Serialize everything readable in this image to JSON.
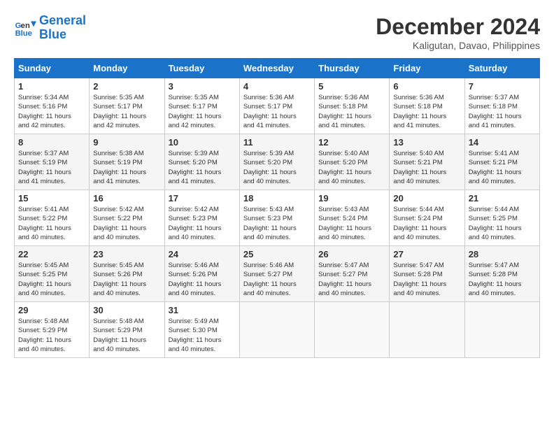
{
  "header": {
    "logo_line1": "General",
    "logo_line2": "Blue",
    "month_title": "December 2024",
    "location": "Kaligutan, Davao, Philippines"
  },
  "weekdays": [
    "Sunday",
    "Monday",
    "Tuesday",
    "Wednesday",
    "Thursday",
    "Friday",
    "Saturday"
  ],
  "weeks": [
    [
      {
        "day": "1",
        "info": "Sunrise: 5:34 AM\nSunset: 5:16 PM\nDaylight: 11 hours\nand 42 minutes."
      },
      {
        "day": "2",
        "info": "Sunrise: 5:35 AM\nSunset: 5:17 PM\nDaylight: 11 hours\nand 42 minutes."
      },
      {
        "day": "3",
        "info": "Sunrise: 5:35 AM\nSunset: 5:17 PM\nDaylight: 11 hours\nand 42 minutes."
      },
      {
        "day": "4",
        "info": "Sunrise: 5:36 AM\nSunset: 5:17 PM\nDaylight: 11 hours\nand 41 minutes."
      },
      {
        "day": "5",
        "info": "Sunrise: 5:36 AM\nSunset: 5:18 PM\nDaylight: 11 hours\nand 41 minutes."
      },
      {
        "day": "6",
        "info": "Sunrise: 5:36 AM\nSunset: 5:18 PM\nDaylight: 11 hours\nand 41 minutes."
      },
      {
        "day": "7",
        "info": "Sunrise: 5:37 AM\nSunset: 5:18 PM\nDaylight: 11 hours\nand 41 minutes."
      }
    ],
    [
      {
        "day": "8",
        "info": "Sunrise: 5:37 AM\nSunset: 5:19 PM\nDaylight: 11 hours\nand 41 minutes."
      },
      {
        "day": "9",
        "info": "Sunrise: 5:38 AM\nSunset: 5:19 PM\nDaylight: 11 hours\nand 41 minutes."
      },
      {
        "day": "10",
        "info": "Sunrise: 5:39 AM\nSunset: 5:20 PM\nDaylight: 11 hours\nand 41 minutes."
      },
      {
        "day": "11",
        "info": "Sunrise: 5:39 AM\nSunset: 5:20 PM\nDaylight: 11 hours\nand 40 minutes."
      },
      {
        "day": "12",
        "info": "Sunrise: 5:40 AM\nSunset: 5:20 PM\nDaylight: 11 hours\nand 40 minutes."
      },
      {
        "day": "13",
        "info": "Sunrise: 5:40 AM\nSunset: 5:21 PM\nDaylight: 11 hours\nand 40 minutes."
      },
      {
        "day": "14",
        "info": "Sunrise: 5:41 AM\nSunset: 5:21 PM\nDaylight: 11 hours\nand 40 minutes."
      }
    ],
    [
      {
        "day": "15",
        "info": "Sunrise: 5:41 AM\nSunset: 5:22 PM\nDaylight: 11 hours\nand 40 minutes."
      },
      {
        "day": "16",
        "info": "Sunrise: 5:42 AM\nSunset: 5:22 PM\nDaylight: 11 hours\nand 40 minutes."
      },
      {
        "day": "17",
        "info": "Sunrise: 5:42 AM\nSunset: 5:23 PM\nDaylight: 11 hours\nand 40 minutes."
      },
      {
        "day": "18",
        "info": "Sunrise: 5:43 AM\nSunset: 5:23 PM\nDaylight: 11 hours\nand 40 minutes."
      },
      {
        "day": "19",
        "info": "Sunrise: 5:43 AM\nSunset: 5:24 PM\nDaylight: 11 hours\nand 40 minutes."
      },
      {
        "day": "20",
        "info": "Sunrise: 5:44 AM\nSunset: 5:24 PM\nDaylight: 11 hours\nand 40 minutes."
      },
      {
        "day": "21",
        "info": "Sunrise: 5:44 AM\nSunset: 5:25 PM\nDaylight: 11 hours\nand 40 minutes."
      }
    ],
    [
      {
        "day": "22",
        "info": "Sunrise: 5:45 AM\nSunset: 5:25 PM\nDaylight: 11 hours\nand 40 minutes."
      },
      {
        "day": "23",
        "info": "Sunrise: 5:45 AM\nSunset: 5:26 PM\nDaylight: 11 hours\nand 40 minutes."
      },
      {
        "day": "24",
        "info": "Sunrise: 5:46 AM\nSunset: 5:26 PM\nDaylight: 11 hours\nand 40 minutes."
      },
      {
        "day": "25",
        "info": "Sunrise: 5:46 AM\nSunset: 5:27 PM\nDaylight: 11 hours\nand 40 minutes."
      },
      {
        "day": "26",
        "info": "Sunrise: 5:47 AM\nSunset: 5:27 PM\nDaylight: 11 hours\nand 40 minutes."
      },
      {
        "day": "27",
        "info": "Sunrise: 5:47 AM\nSunset: 5:28 PM\nDaylight: 11 hours\nand 40 minutes."
      },
      {
        "day": "28",
        "info": "Sunrise: 5:47 AM\nSunset: 5:28 PM\nDaylight: 11 hours\nand 40 minutes."
      }
    ],
    [
      {
        "day": "29",
        "info": "Sunrise: 5:48 AM\nSunset: 5:29 PM\nDaylight: 11 hours\nand 40 minutes."
      },
      {
        "day": "30",
        "info": "Sunrise: 5:48 AM\nSunset: 5:29 PM\nDaylight: 11 hours\nand 40 minutes."
      },
      {
        "day": "31",
        "info": "Sunrise: 5:49 AM\nSunset: 5:30 PM\nDaylight: 11 hours\nand 40 minutes."
      },
      {
        "day": "",
        "info": ""
      },
      {
        "day": "",
        "info": ""
      },
      {
        "day": "",
        "info": ""
      },
      {
        "day": "",
        "info": ""
      }
    ]
  ]
}
